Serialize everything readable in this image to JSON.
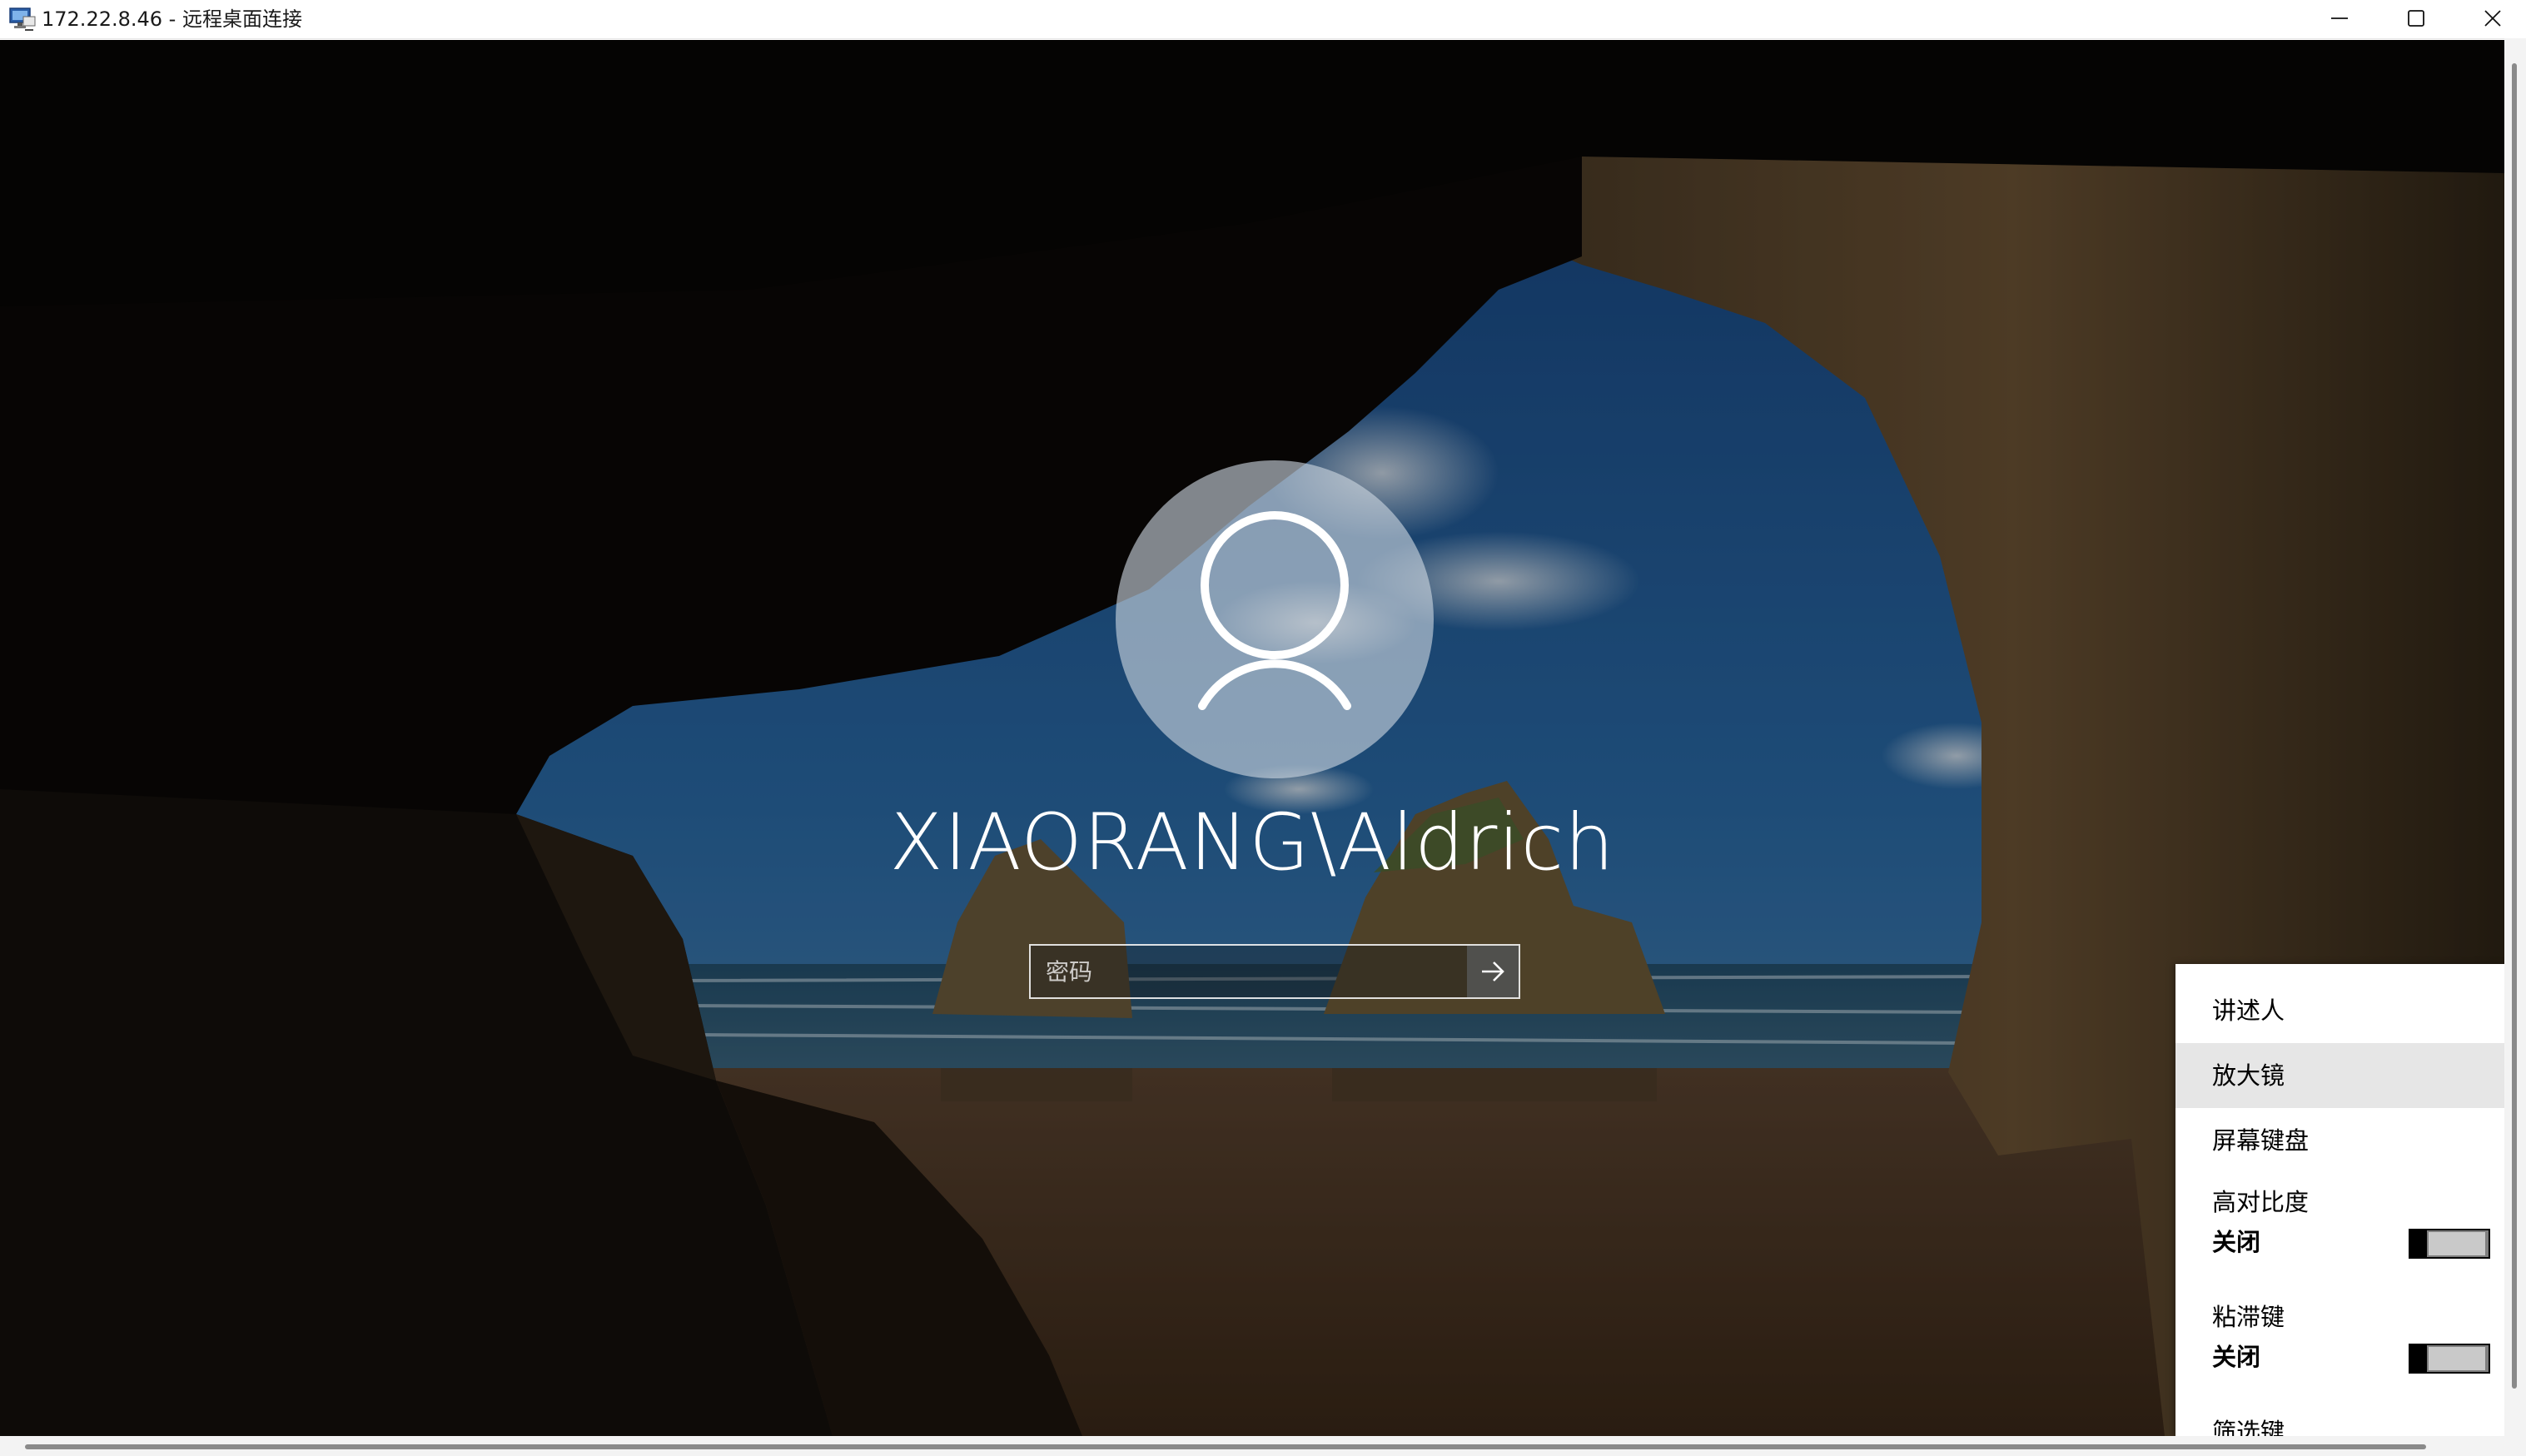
{
  "window": {
    "title": "172.22.8.46 - 远程桌面连接",
    "icon": "remote-desktop-icon",
    "controls": [
      "minimize-icon",
      "maximize-icon",
      "close-icon"
    ]
  },
  "lock_screen": {
    "avatar_icon": "user-icon",
    "username": "XIAORANG\\Aldrich",
    "password": {
      "placeholder": "密码",
      "value": ""
    },
    "submit_icon": "arrow-right-icon"
  },
  "ease_of_access_menu": {
    "narrator": "讲述人",
    "magnifier": "放大镜",
    "on_screen_keyboard": "屏幕键盘",
    "high_contrast": {
      "label": "高对比度",
      "state": "关闭",
      "on": false
    },
    "sticky_keys": {
      "label": "粘滞键",
      "state": "关闭",
      "on": false
    },
    "filter_keys": {
      "label": "筛选键"
    }
  },
  "colors": {
    "titlebar": "#ffffff",
    "menu_background": "#ffffff",
    "menu_hover": "#e6e6e6",
    "toggle_off": "#c9c9c9"
  }
}
